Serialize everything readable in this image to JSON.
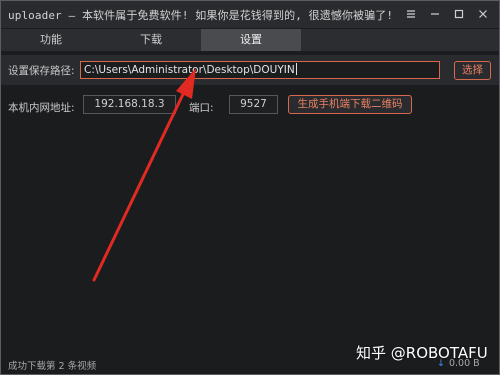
{
  "window": {
    "title": "uploader — 本软件属于免费软件! 如果你是花钱得到的, 很遗憾你被骗了!"
  },
  "tabs": [
    {
      "label": "功能"
    },
    {
      "label": "下载"
    },
    {
      "label": "设置",
      "active": true
    }
  ],
  "settings": {
    "save_path_label": "设置保存路径:",
    "save_path_value": "C:\\Users\\Administrator\\Desktop\\DOUYIN",
    "choose_button": "选择",
    "lan_label": "本机内网地址:",
    "lan_ip": "192.168.18.3",
    "port_label": "端口:",
    "port_value": "9527",
    "qr_button": "生成手机端下载二维码"
  },
  "status_bar": {
    "downloaded": "成功下载第 2 条视频",
    "speed": "0.00 B"
  },
  "watermark": "知乎 @ROBOTAFU",
  "colors": {
    "accent": "#d9694d",
    "background": "#1b1c1e",
    "annotation_arrow": "#e02a22"
  }
}
